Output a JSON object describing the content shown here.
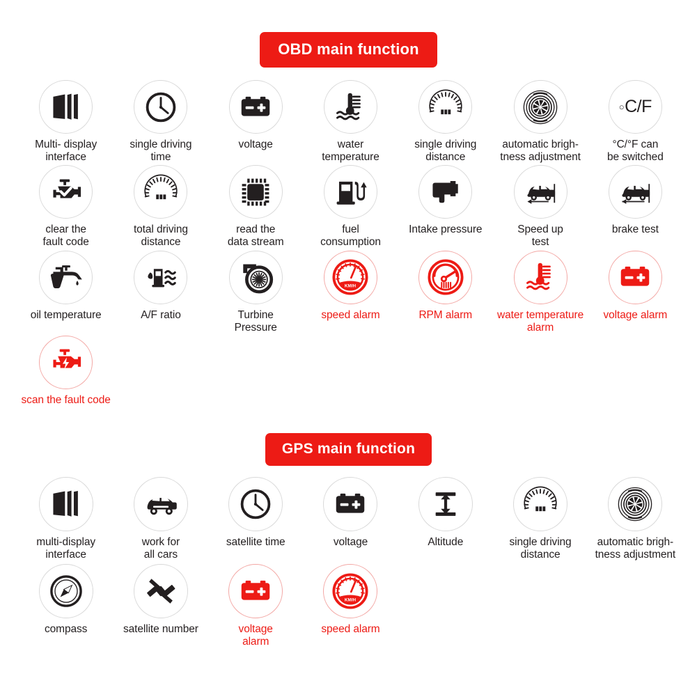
{
  "background_color": "#ffffff",
  "accent_color": "#ED1B15",
  "text_color": "#231f20",
  "sections": [
    {
      "id": "obd",
      "header": "OBD main function",
      "items": [
        {
          "icon": "multi-display-panels-icon",
          "label": "Multi- display\ninterface",
          "color": "black"
        },
        {
          "icon": "clock-icon",
          "label": "single driving\ntime",
          "color": "black"
        },
        {
          "icon": "battery-icon",
          "label": "voltage",
          "color": "black"
        },
        {
          "icon": "water-thermometer-icon",
          "label": "water\ntemperature",
          "color": "black"
        },
        {
          "icon": "speedometer-odometer-icon",
          "label": "single driving\ndistance",
          "color": "black"
        },
        {
          "icon": "aperture-brightness-icon",
          "label": "automatic brigh-\ntness adjustment",
          "color": "black"
        },
        {
          "icon": "celsius-fahrenheit-icon",
          "label": "°C/°F can\nbe switched",
          "color": "black",
          "glyph": "°C/F"
        },
        {
          "icon": "engine-check-icon",
          "label": "clear the\nfault code",
          "color": "black"
        },
        {
          "icon": "speedometer-odometer-icon",
          "label": "total driving\ndistance",
          "color": "black"
        },
        {
          "icon": "chip-icon",
          "label": "read the\ndata stream",
          "color": "black"
        },
        {
          "icon": "fuel-pump-icon",
          "label": "fuel\nconsumption",
          "color": "black"
        },
        {
          "icon": "intake-sensor-icon",
          "label": "Intake pressure",
          "color": "black"
        },
        {
          "icon": "car-accelerate-icon",
          "label": "Speed up\ntest",
          "color": "black"
        },
        {
          "icon": "car-brake-icon",
          "label": "brake test",
          "color": "black"
        },
        {
          "icon": "oil-can-icon",
          "label": "oil temperature",
          "color": "black"
        },
        {
          "icon": "fuel-air-waves-icon",
          "label": "A/F ratio",
          "color": "black"
        },
        {
          "icon": "turbine-icon",
          "label": "Turbine\nPressure",
          "color": "black"
        },
        {
          "icon": "speed-gauge-alarm-icon",
          "label": "speed alarm",
          "color": "red",
          "glyph": "KM/H"
        },
        {
          "icon": "rpm-gauge-alarm-icon",
          "label": "RPM alarm",
          "color": "red"
        },
        {
          "icon": "water-thermometer-icon",
          "label": "water temperature\nalarm",
          "color": "red"
        },
        {
          "icon": "battery-icon",
          "label": "voltage alarm",
          "color": "red"
        },
        {
          "icon": "engine-scan-icon",
          "label": "scan the fault code",
          "color": "red"
        }
      ]
    },
    {
      "id": "gps",
      "header": "GPS main function",
      "items": [
        {
          "icon": "multi-display-panels-icon",
          "label": "multi-display\ninterface",
          "color": "black"
        },
        {
          "icon": "car-icon",
          "label": "work for\nall cars",
          "color": "black"
        },
        {
          "icon": "clock-icon",
          "label": "satellite time",
          "color": "black"
        },
        {
          "icon": "battery-icon",
          "label": "voltage",
          "color": "black"
        },
        {
          "icon": "altitude-arrow-icon",
          "label": "Altitude",
          "color": "black"
        },
        {
          "icon": "speedometer-odometer-icon",
          "label": "single driving\ndistance",
          "color": "black"
        },
        {
          "icon": "aperture-brightness-icon",
          "label": "automatic brigh-\ntness adjustment",
          "color": "black"
        },
        {
          "icon": "compass-icon",
          "label": "compass",
          "color": "black"
        },
        {
          "icon": "satellite-icon",
          "label": "satellite number",
          "color": "black"
        },
        {
          "icon": "battery-icon",
          "label": "voltage\nalarm",
          "color": "red"
        },
        {
          "icon": "speed-gauge-alarm-icon",
          "label": "speed alarm",
          "color": "red",
          "glyph": "KM/H"
        }
      ]
    }
  ]
}
